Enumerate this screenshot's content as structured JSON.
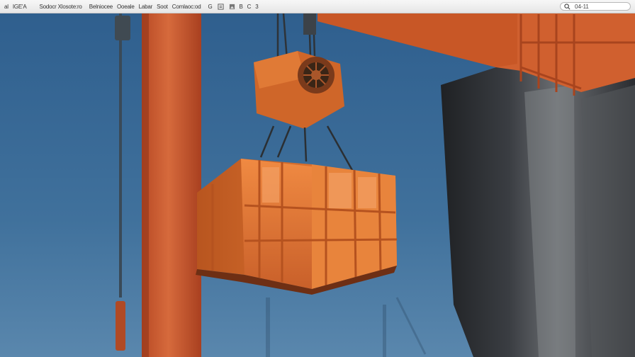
{
  "toolbar": {
    "items": [
      "al",
      "IGE'A",
      "Sodocr Xlosote:ro",
      "Belniocee",
      "Ooeale",
      "Labar",
      "Soot",
      "Comlaoc:od",
      "G",
      "B",
      "C",
      "3"
    ],
    "search_value": "04-11"
  },
  "colors": {
    "sky_top": "#2f5f8e",
    "sky_bottom": "#5a87ad",
    "crane_orange": "#d4602f",
    "container_orange": "#e77a33",
    "dark_structure": "#2b2d30"
  },
  "icons": [
    "document-icon",
    "image-icon",
    "search-icon"
  ]
}
